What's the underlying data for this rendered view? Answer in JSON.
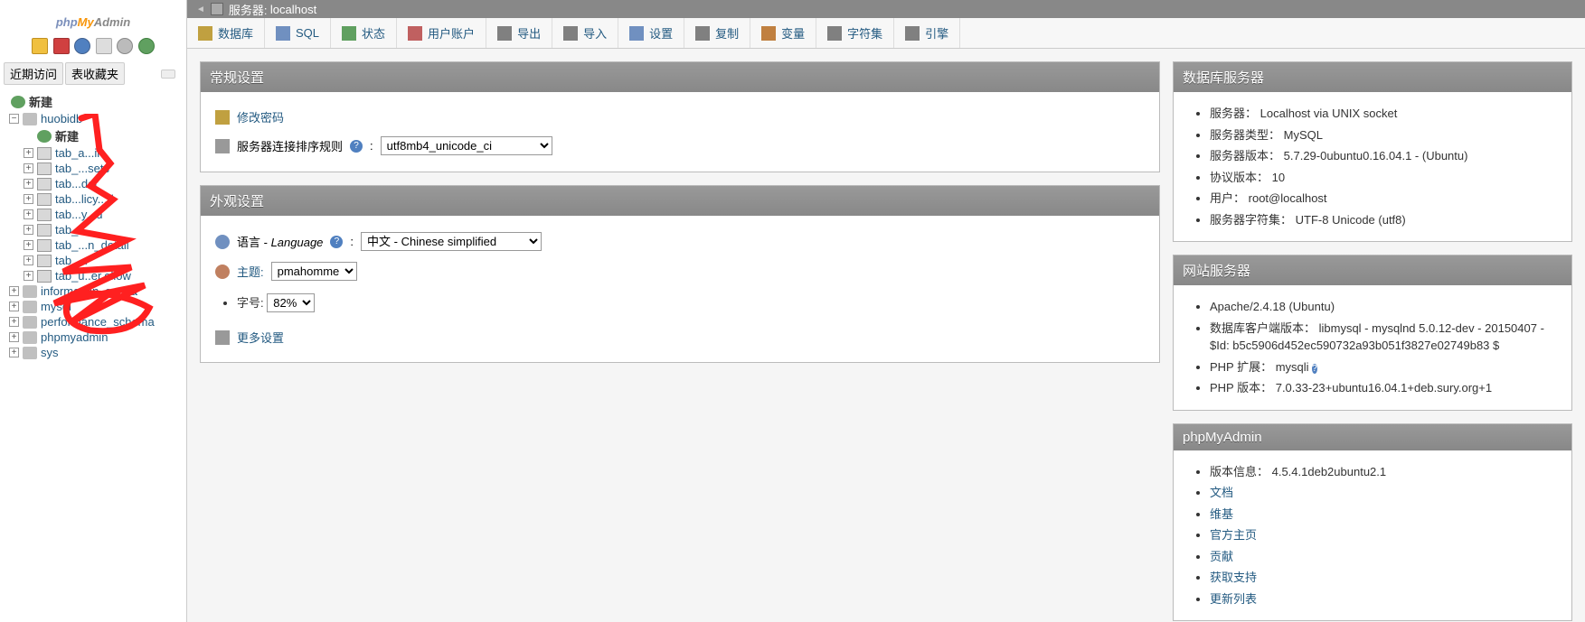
{
  "logo": {
    "p1": "php",
    "p2": "My",
    "p3": "Admin"
  },
  "leftTabs": {
    "recent": "近期访问",
    "favorites": "表收藏夹"
  },
  "tree": {
    "new": "新建",
    "db": "huobidb",
    "db_new": "新建",
    "tables": [
      "tab_a...in",
      "tab_...sets",
      "tab...der",
      "tab...licy...d",
      "tab...y...d",
      "tab_t...",
      "tab_...n_detail",
      "tab_...",
      "tab_u..er.ollow"
    ],
    "others": [
      "information_s...ma",
      "mysql",
      "performance_schema",
      "phpmyadmin",
      "sys"
    ]
  },
  "breadcrumb": {
    "server_label": "服务器:",
    "server": "localhost"
  },
  "menu": [
    {
      "id": "databases",
      "label": "数据库",
      "ic": "ic-db"
    },
    {
      "id": "sql",
      "label": "SQL",
      "ic": "ic-sql"
    },
    {
      "id": "status",
      "label": "状态",
      "ic": "ic-status"
    },
    {
      "id": "users",
      "label": "用户账户",
      "ic": "ic-users"
    },
    {
      "id": "export",
      "label": "导出",
      "ic": "ic-export"
    },
    {
      "id": "import",
      "label": "导入",
      "ic": "ic-import"
    },
    {
      "id": "settings",
      "label": "设置",
      "ic": "ic-settings"
    },
    {
      "id": "replication",
      "label": "复制",
      "ic": "ic-repl"
    },
    {
      "id": "variables",
      "label": "变量",
      "ic": "ic-var"
    },
    {
      "id": "charsets",
      "label": "字符集",
      "ic": "ic-charset"
    },
    {
      "id": "engines",
      "label": "引擎",
      "ic": "ic-engine"
    }
  ],
  "general": {
    "title": "常规设置",
    "change_pw": "修改密码",
    "collation_label": "服务器连接排序规则",
    "collation_value": "utf8mb4_unicode_ci"
  },
  "appearance": {
    "title": "外观设置",
    "lang_label": "语言 - ",
    "lang_label_i": "Language",
    "lang_value": "中文 - Chinese simplified",
    "theme_label": "主题:",
    "theme_value": "pmahomme",
    "font_label": "字号:",
    "font_value": "82%",
    "more": "更多设置"
  },
  "db_server": {
    "title": "数据库服务器",
    "rows": [
      {
        "k": "服务器：",
        "v": "Localhost via UNIX socket"
      },
      {
        "k": "服务器类型：",
        "v": "MySQL"
      },
      {
        "k": "服务器版本：",
        "v": "5.7.29-0ubuntu0.16.04.1 - (Ubuntu)"
      },
      {
        "k": "协议版本：",
        "v": "10"
      },
      {
        "k": "用户：",
        "v": "root@localhost"
      },
      {
        "k": "服务器字符集：",
        "v": "UTF-8 Unicode (utf8)"
      }
    ]
  },
  "web_server": {
    "title": "网站服务器",
    "rows": [
      "Apache/2.4.18 (Ubuntu)",
      "数据库客户端版本：  libmysql - mysqlnd 5.0.12-dev - 20150407 - $Id: b5c5906d452ec590732a93b051f3827e02749b83 $",
      "PHP 扩展：  mysqli",
      "PHP 版本：  7.0.33-23+ubuntu16.04.1+deb.sury.org+1"
    ]
  },
  "pma": {
    "title": "phpMyAdmin",
    "version_label": "版本信息：",
    "version": "4.5.4.1deb2ubuntu2.1",
    "links": [
      "文档",
      "维基",
      "官方主页",
      "贡献",
      "获取支持",
      "更新列表"
    ]
  }
}
